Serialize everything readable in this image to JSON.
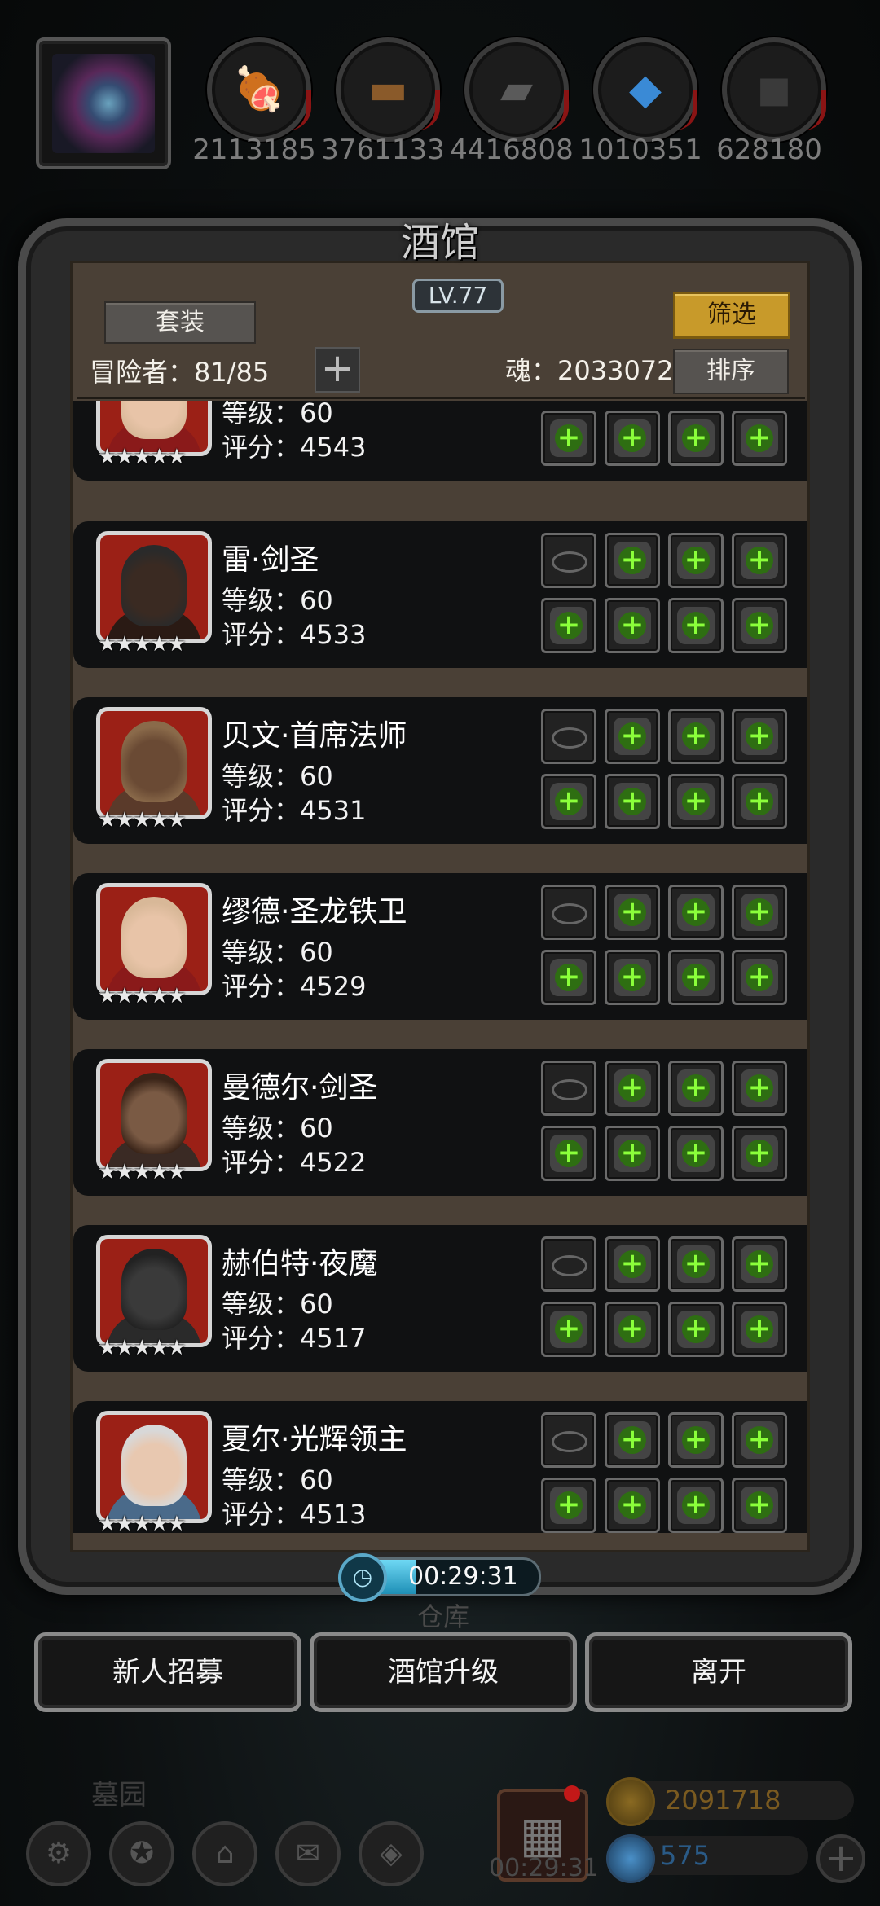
{
  "resources": {
    "items": [
      {
        "icon": "meat-icon",
        "value": "2113185"
      },
      {
        "icon": "wood-icon",
        "value": "3761133"
      },
      {
        "icon": "iron-icon",
        "value": "4416808"
      },
      {
        "icon": "crystal-icon",
        "value": "1010351"
      },
      {
        "icon": "ore-icon",
        "value": "628180"
      }
    ]
  },
  "tavern": {
    "title": "酒馆",
    "level": "LV.77",
    "set_button": "套装",
    "filter_button": "筛选",
    "sort_button": "排序",
    "adventurers_label": "冒险者：81/85",
    "soul_label": "魂：2033072"
  },
  "heroes": [
    {
      "name": "",
      "level": "等级：60",
      "score": "评分：4543"
    },
    {
      "name": "雷·剑圣",
      "level": "等级：60",
      "score": "评分：4533"
    },
    {
      "name": "贝文·首席法师",
      "level": "等级：60",
      "score": "评分：4531"
    },
    {
      "name": "缪德·圣龙铁卫",
      "level": "等级：60",
      "score": "评分：4529"
    },
    {
      "name": "曼德尔·剑圣",
      "level": "等级：60",
      "score": "评分：4522"
    },
    {
      "name": "赫伯特·夜魔",
      "level": "等级：60",
      "score": "评分：4517"
    },
    {
      "name": "夏尔·光辉领主",
      "level": "等级：60",
      "score": "评分：4513"
    }
  ],
  "stars": "★★★★★",
  "timer": {
    "text": "00:29:31",
    "progress": 0.37
  },
  "warehouse_label": "仓库",
  "actions": {
    "recruit": "新人招募",
    "upgrade": "酒馆升级",
    "leave": "离开"
  },
  "hud": {
    "cemetery_label": "墓园",
    "gift_timer": "00:29:31",
    "gold": "2091718",
    "gems": "575"
  }
}
